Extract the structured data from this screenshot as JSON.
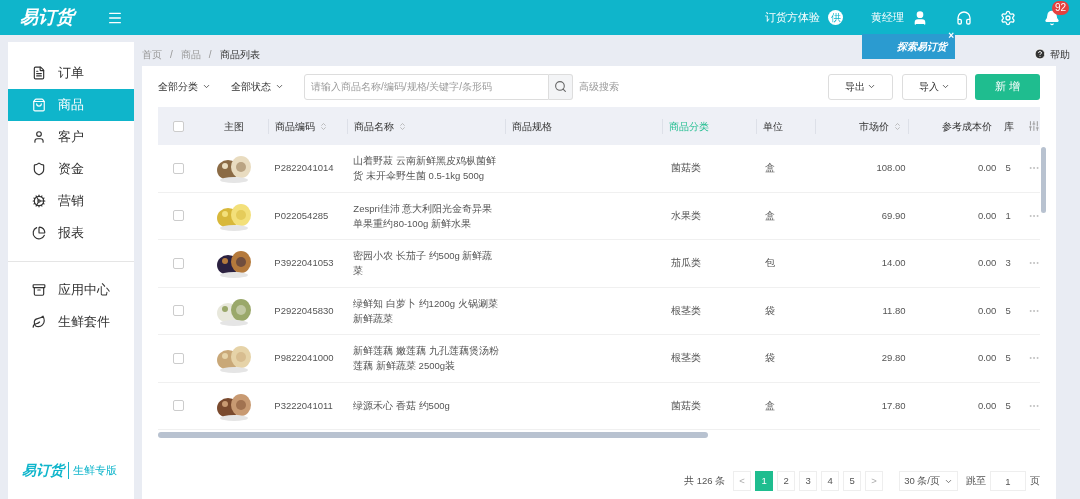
{
  "topbar": {
    "logo": "易订货",
    "links": [
      {
        "kind": "experience",
        "label": "订货方体验",
        "badge": "供"
      },
      {
        "kind": "user",
        "label": "黄经理"
      },
      {
        "kind": "service"
      },
      {
        "kind": "settings"
      },
      {
        "kind": "bell",
        "badge": "92"
      }
    ]
  },
  "sidebar": {
    "items": [
      {
        "label": "订单",
        "selected": false
      },
      {
        "label": "商品",
        "selected": true
      },
      {
        "label": "客户",
        "selected": false
      },
      {
        "label": "资金",
        "selected": false
      },
      {
        "label": "营销",
        "selected": false
      },
      {
        "label": "报表",
        "selected": false
      },
      {
        "label": "应用中心",
        "selected": false
      },
      {
        "label": "生鲜套件",
        "selected": false
      }
    ],
    "footer_logo": "易订货",
    "footer_label": "生鲜专版"
  },
  "breadcrumb": {
    "separator": "/",
    "items": [
      "首页",
      "商品",
      "商品列表"
    ]
  },
  "promo": {
    "label": "探索易订货",
    "close": "×"
  },
  "help": "帮助",
  "toolbar": {
    "filters": [
      "全部分类",
      "全部状态"
    ],
    "search": {
      "placeholder": "请输入商品名称/编码/规格/关键字/条形码"
    },
    "advanced": "高级搜索",
    "export": "导出",
    "import": "导入",
    "add": "新 增"
  },
  "table": {
    "select_all_checked": false,
    "columns": [
      {
        "label": "主图",
        "sortable": false,
        "highlight": false
      },
      {
        "label": "商品编码",
        "sortable": true,
        "highlight": false
      },
      {
        "label": "商品名称",
        "sortable": true,
        "highlight": false
      },
      {
        "label": "商品规格",
        "sortable": false,
        "highlight": false
      },
      {
        "label": "商品分类",
        "sortable": false,
        "highlight": true
      },
      {
        "label": "单位",
        "sortable": false,
        "highlight": false
      },
      {
        "label": "市场价",
        "sortable": true,
        "highlight": false
      },
      {
        "label": "参考成本价",
        "sortable": false,
        "highlight": false
      },
      {
        "label": "库",
        "sortable": false,
        "highlight": false
      }
    ],
    "rows": [
      {
        "checked": false,
        "code": "P2822041014",
        "name": "山着野菽 云南新鲜黑皮鸡枞菌鲜货 未开伞野生菌 0.5-1kg 500g",
        "category": "菌菇类",
        "unit": "盒",
        "price": "108.00",
        "cost": "0.00",
        "stock": "5"
      },
      {
        "checked": false,
        "code": "P022054285",
        "name": "Zespri佳沛 意大利阳光金奇异果单果重约80-100g 新鲜水果",
        "category": "水果类",
        "unit": "盒",
        "price": "69.90",
        "cost": "0.00",
        "stock": "1"
      },
      {
        "checked": false,
        "code": "P3922041053",
        "name": "密园小农 长茄子 约500g 新鲜蔬菜",
        "category": "茄瓜类",
        "unit": "包",
        "price": "14.00",
        "cost": "0.00",
        "stock": "3"
      },
      {
        "checked": false,
        "code": "P2922045830",
        "name": "绿鲜知 白萝卜 约1200g 火锅涮菜新鲜蔬菜",
        "category": "根茎类",
        "unit": "袋",
        "price": "11.80",
        "cost": "0.00",
        "stock": "5"
      },
      {
        "checked": false,
        "code": "P9822041000",
        "name": "新鲜莲藕 嫩莲藕 九孔莲藕煲汤粉莲藕 新鲜蔬菜 2500g装",
        "category": "根茎类",
        "unit": "袋",
        "price": "29.80",
        "cost": "0.00",
        "stock": "5"
      },
      {
        "checked": false,
        "code": "P3222041011",
        "name": "绿源禾心 香菇 约500g",
        "category": "菌菇类",
        "unit": "盒",
        "price": "17.80",
        "cost": "0.00",
        "stock": "5"
      }
    ]
  },
  "pagination": {
    "total": "共 126 条",
    "prev": "<",
    "pages": [
      {
        "label": "1",
        "selected": true
      },
      {
        "label": "2",
        "selected": false
      },
      {
        "label": "3",
        "selected": false
      },
      {
        "label": "4",
        "selected": false
      },
      {
        "label": "5",
        "selected": false
      }
    ],
    "next": ">",
    "page_size": "30 条/页",
    "goto_label": "跳至",
    "goto_value": "1",
    "goto_suffix": "页"
  }
}
